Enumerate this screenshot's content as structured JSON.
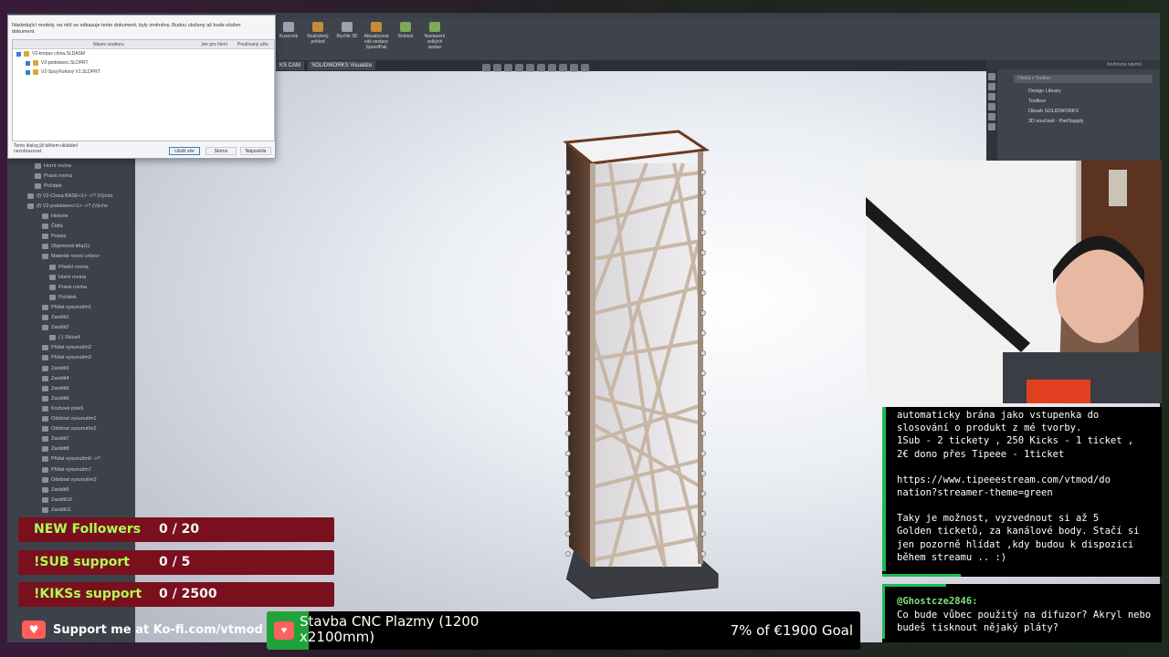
{
  "solidworks": {
    "ribbon": [
      {
        "label": "Kusovník",
        "icon": "bom-icon"
      },
      {
        "label": "Rozložený pohled",
        "icon": "exploded-view-icon"
      },
      {
        "label": "Rychlé 3D",
        "icon": "instant3d-icon"
      },
      {
        "label": "Aktualizovat ešit sestavy SpeedPak",
        "icon": "speedpak-icon"
      },
      {
        "label": "Snímek",
        "icon": "snapshot-icon"
      },
      {
        "label": "Nastavení velkých sestav",
        "icon": "large-assembly-icon"
      }
    ],
    "command_tabs": [
      "KS CAM",
      "SOLIDWORKS Visualize"
    ],
    "tree_items": [
      "Horní rovina",
      "Pravá rovina",
      "Počátek",
      "(f) V2-Clona BASE<1> ->? (Výcho",
      "(f) V2-podstavec<1> ->? (Výcho",
      "Historie",
      "Čidla",
      "Popisy",
      "Objemová těla(1)",
      "Materiál <není určen>",
      "Přední rovina",
      "Horní rovina",
      "Pravá rovina",
      "Počátek",
      "Přidat vysunutím1",
      "Zaoblit1",
      "Zaoblit2",
      "(-) Skica4",
      "Přidat vysunutím2",
      "Přidat vysunutím3",
      "Zaoblit3",
      "Zaoblit4",
      "Zaoblit5",
      "Zaoblit6",
      "Kruhové pole6",
      "Odebrat vysunutím1",
      "Odebrat vysunutím2",
      "Zaoblit7",
      "Zaoblit8",
      "Přidat vysunutím6 ->?",
      "Přidat vysunutím7",
      "Odebrat vysunutím3",
      "Zaoblit9",
      "Zaoblit10",
      "Zaoblit11"
    ],
    "task_pane": {
      "header": "Knihovna návrhů",
      "search_placeholder": "Hledat v Toolbox",
      "items": [
        "Design Library",
        "Toolbox",
        "Obsah SOLIDWORKS",
        "3D součásti - PartSupply"
      ]
    },
    "dialog": {
      "message": "Následující modely, na něž se odkazuje tento dokument, byly změněny. Budou uloženy až bude uložen dokument.",
      "columns": [
        "Název souboru",
        "Jen pro čtení",
        "Používaný uživ."
      ],
      "files": [
        "V2-korpus clona.SLDASM",
        "V2-podstavec.SLDPRT",
        "V2-Spoj Rohový V1.SLDPRT"
      ],
      "footer_note": "Tento dialog již během ukládání nezobrazovat",
      "buttons": [
        "Uložit vše",
        "Storno",
        "Nápověda"
      ]
    }
  },
  "chat": {
    "info_lines": [
      "automaticky brána jako vstupenka do",
      "slosování o produkt z mé tvorby.",
      "1Sub - 2 tickety , 250 Kicks - 1 ticket ,",
      "2€ dono přes Tipeee - 1ticket",
      "",
      "https://www.tipeeestream.com/vtmod/do",
      "nation?streamer-theme=green",
      "",
      "Taky je možnost, vyzvednout si až 5",
      "Golden ticketů, za kanálové body. Stačí si",
      "jen pozorně hlídat ,kdy budou k dispozici",
      "během streamu .. :)"
    ],
    "last_message": {
      "user": "@Ghostcze2846:",
      "text": "Co bude vůbec použitý na difuzor? Akryl nebo budeš tisknout nějaký pláty?"
    }
  },
  "goals": [
    {
      "label": "NEW Followers",
      "value": "0 / 20"
    },
    {
      "label": "!SUB support",
      "value": "0 / 5"
    },
    {
      "label": "!KIKSs support",
      "value": "0 / 2500"
    }
  ],
  "kofi": {
    "text": "Support me at Ko-fi.com/vtmod"
  },
  "donation": {
    "title": "Stavba CNC Plazmy (1200 x2100mm)",
    "goal_text": "7% of €1900 Goal",
    "progress": 0.07,
    "color": "#21a33a"
  },
  "colors": {
    "goal_bg": "#7a0f1e",
    "goal_label": "#aaff55",
    "chat_accent": "#1db954"
  }
}
